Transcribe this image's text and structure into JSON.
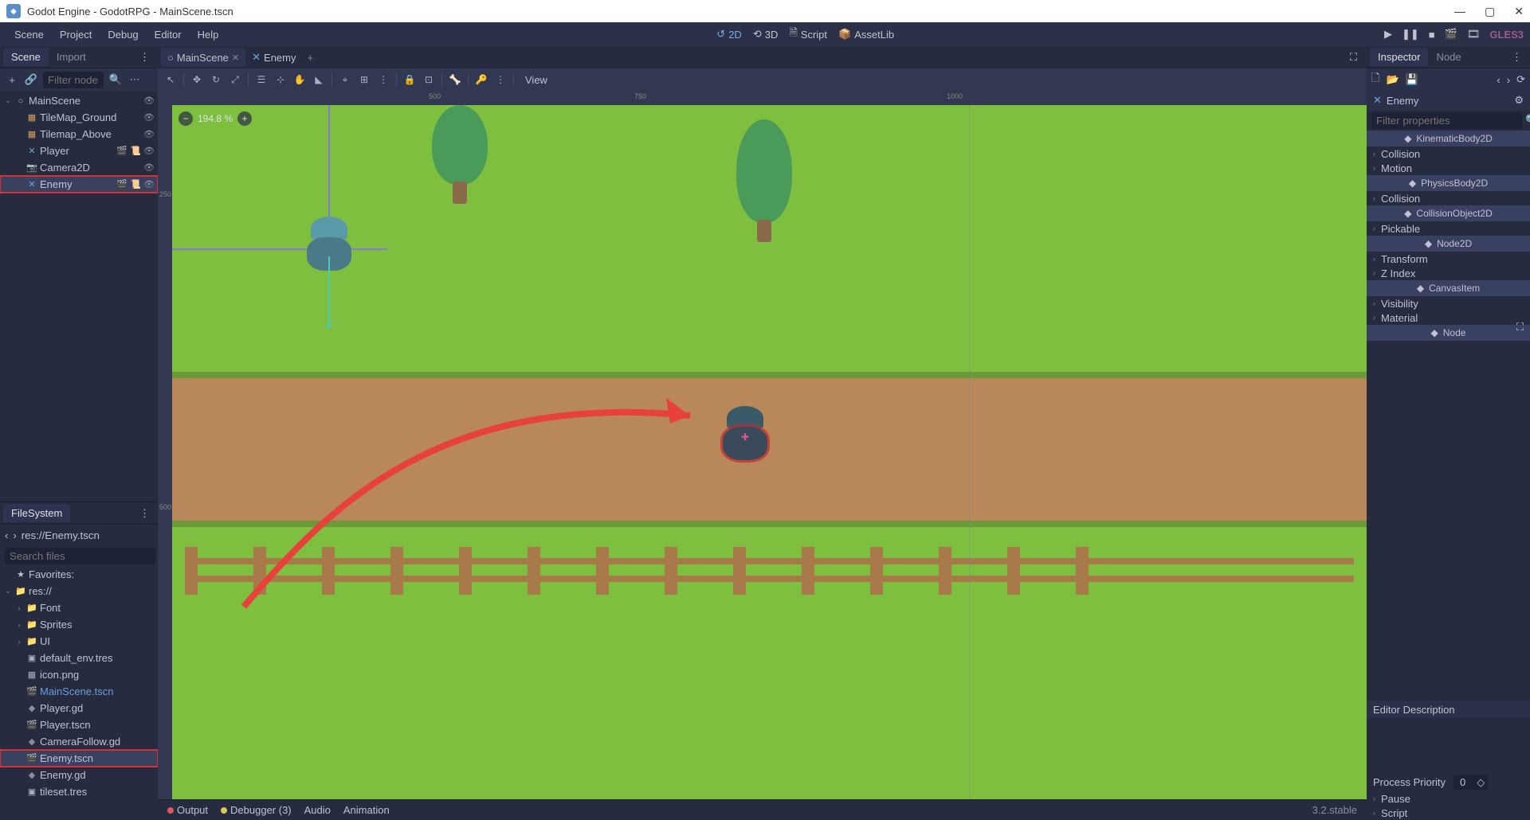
{
  "title": "Godot Engine - GodotRPG - MainScene.tscn",
  "menu": [
    "Scene",
    "Project",
    "Debug",
    "Editor",
    "Help"
  ],
  "topCenter": {
    "mode2d": "2D",
    "mode3d": "3D",
    "script": "Script",
    "assetlib": "AssetLib"
  },
  "gles": "GLES3",
  "leftTabs": {
    "scene": "Scene",
    "import": "Import"
  },
  "sceneFilter": "Filter nodes",
  "sceneTree": [
    {
      "name": "MainScene",
      "icon": "node",
      "depth": 0,
      "exp": "⌄",
      "eye": true
    },
    {
      "name": "TileMap_Ground",
      "icon": "tile",
      "depth": 1,
      "eye": true
    },
    {
      "name": "Tilemap_Above",
      "icon": "tile",
      "depth": 1,
      "eye": true
    },
    {
      "name": "Player",
      "icon": "kin",
      "depth": 1,
      "eye": true,
      "extra": [
        "film",
        "script"
      ]
    },
    {
      "name": "Camera2D",
      "icon": "cam",
      "depth": 1,
      "eye": true
    },
    {
      "name": "Enemy",
      "icon": "kin",
      "depth": 1,
      "eye": true,
      "extra": [
        "film",
        "script"
      ],
      "sel": true,
      "hl": true
    }
  ],
  "fs": {
    "title": "FileSystem",
    "path": "res://Enemy.tscn",
    "search": "Search files",
    "fav": "Favorites:",
    "items": [
      {
        "name": "res://",
        "icon": "fol",
        "depth": 0,
        "exp": "⌄"
      },
      {
        "name": "Font",
        "icon": "fol",
        "depth": 1,
        "exp": "›"
      },
      {
        "name": "Sprites",
        "icon": "fol",
        "depth": 1,
        "exp": "›"
      },
      {
        "name": "UI",
        "icon": "fol",
        "depth": 1,
        "exp": "›"
      },
      {
        "name": "default_env.tres",
        "icon": "res",
        "depth": 1
      },
      {
        "name": "icon.png",
        "icon": "img",
        "depth": 1
      },
      {
        "name": "MainScene.tscn",
        "icon": "scn",
        "depth": 1,
        "cur": true
      },
      {
        "name": "Player.gd",
        "icon": "gd",
        "depth": 1
      },
      {
        "name": "Player.tscn",
        "icon": "scn",
        "depth": 1
      },
      {
        "name": "CameraFollow.gd",
        "icon": "gd",
        "depth": 1
      },
      {
        "name": "Enemy.tscn",
        "icon": "scn",
        "depth": 1,
        "sel": true,
        "hl": true
      },
      {
        "name": "Enemy.gd",
        "icon": "gd",
        "depth": 1
      },
      {
        "name": "tileset.tres",
        "icon": "res",
        "depth": 1
      }
    ]
  },
  "sceneTabs": [
    {
      "name": "MainScene",
      "icon": "node",
      "active": true,
      "close": true
    },
    {
      "name": "Enemy",
      "icon": "kin",
      "active": false,
      "close": false
    }
  ],
  "vpView": "View",
  "rulerH": [
    {
      "v": "500",
      "p": 340
    },
    {
      "v": "750",
      "p": 598
    },
    {
      "v": "1000",
      "p": 990
    }
  ],
  "rulerV": [
    {
      "v": "250",
      "p": 112
    },
    {
      "v": "500",
      "p": 505
    }
  ],
  "zoom": "194.8 %",
  "botbar": {
    "output": "Output",
    "debugger": "Debugger (3)",
    "audio": "Audio",
    "anim": "Animation",
    "version": "3.2.stable"
  },
  "rightTabs": {
    "inspector": "Inspector",
    "node": "Node"
  },
  "inspector": {
    "node": "Enemy",
    "filter": "Filter properties",
    "sections": [
      {
        "type": "cat",
        "label": "KinematicBody2D",
        "icon": "kin"
      },
      {
        "type": "row",
        "label": "Collision"
      },
      {
        "type": "row",
        "label": "Motion"
      },
      {
        "type": "cat",
        "label": "PhysicsBody2D",
        "icon": "phys"
      },
      {
        "type": "row",
        "label": "Collision"
      },
      {
        "type": "cat",
        "label": "CollisionObject2D",
        "icon": "coll"
      },
      {
        "type": "row",
        "label": "Pickable"
      },
      {
        "type": "cat",
        "label": "Node2D",
        "icon": "n2d"
      },
      {
        "type": "row",
        "label": "Transform"
      },
      {
        "type": "row",
        "label": "Z Index"
      },
      {
        "type": "cat",
        "label": "CanvasItem",
        "icon": "ci"
      },
      {
        "type": "row",
        "label": "Visibility"
      },
      {
        "type": "row",
        "label": "Material"
      },
      {
        "type": "cat",
        "label": "Node",
        "icon": "node"
      }
    ],
    "edDesc": "Editor Description",
    "prio": "Process Priority",
    "prioVal": "0",
    "pause": "Pause",
    "script": "Script"
  }
}
